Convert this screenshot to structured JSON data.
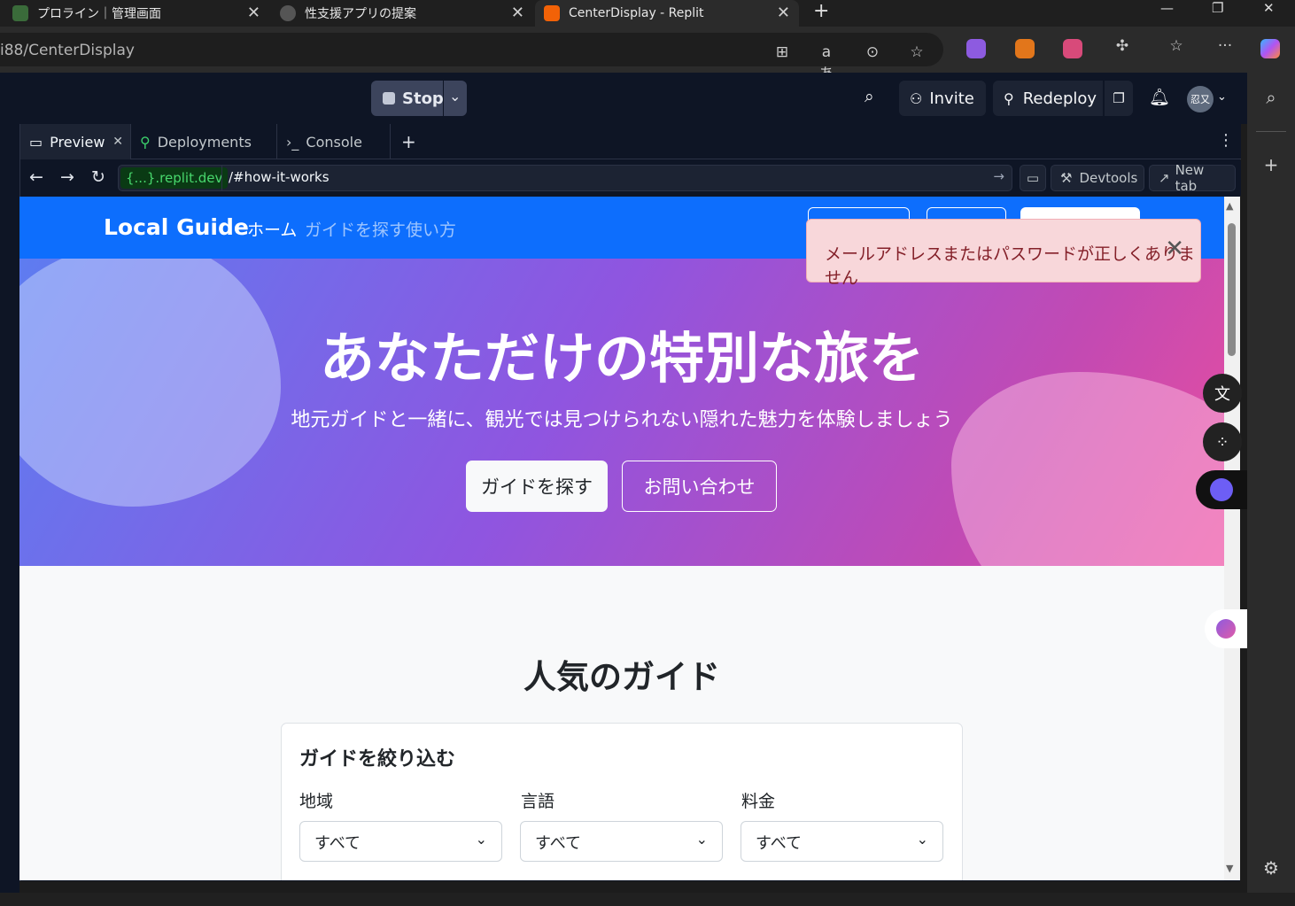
{
  "browser": {
    "tabs": [
      {
        "label": "プロライン｜管理画面"
      },
      {
        "label": "性支援アプリの提案"
      },
      {
        "label": "CenterDisplay - Replit"
      }
    ],
    "address": "i88/CenterDisplay"
  },
  "replit": {
    "stop_label": "Stop",
    "invite_label": "Invite",
    "redeploy_label": "Redeploy",
    "avatar_text": "忍又",
    "pane_tabs": [
      {
        "label": "Preview"
      },
      {
        "label": "Deployments"
      },
      {
        "label": "Console"
      }
    ],
    "url_domain": "{...}.replit.dev",
    "url_path": "/#how-it-works",
    "devtools_label": "Devtools",
    "newtab_label": "New tab"
  },
  "site": {
    "brand": "Local Guide",
    "nav": [
      "ホーム",
      "ガイドを探す",
      "使い方"
    ],
    "hero_title": "あなただけの特別な旅を",
    "hero_subtitle": "地元ガイドと一緒に、観光では見つけられない隠れた魅力を体験しましょう",
    "hero_primary": "ガイドを探す",
    "hero_secondary": "お問い合わせ",
    "section_title": "人気のガイド",
    "filter": {
      "heading": "ガイドを絞り込む",
      "fields": [
        {
          "label": "地域",
          "value": "すべて"
        },
        {
          "label": "言語",
          "value": "すべて"
        },
        {
          "label": "料金",
          "value": "すべて"
        }
      ]
    },
    "toast": "メールアドレスまたはパスワードが正しくありません"
  },
  "colors": {
    "replit_bg": "#0e1525",
    "site_nav": "#0d6efd",
    "toast_bg": "#f8d7da",
    "toast_text": "#842029"
  }
}
